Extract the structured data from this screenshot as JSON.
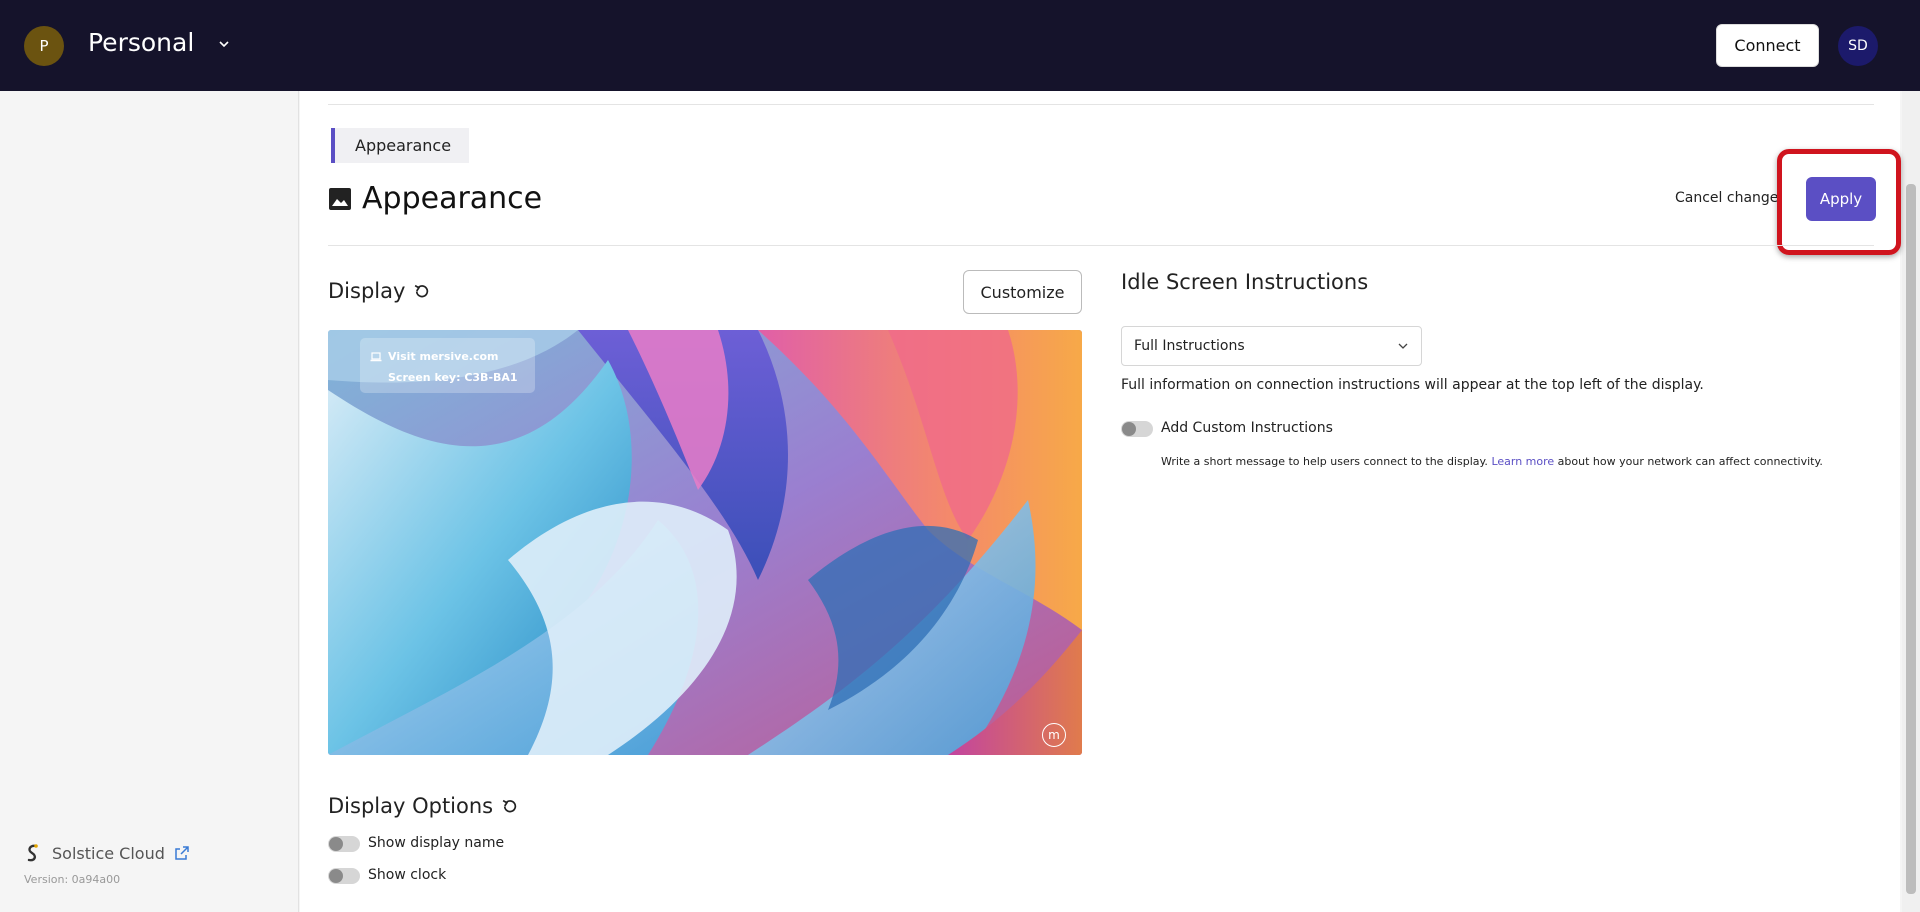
{
  "header": {
    "workspace_initial": "P",
    "workspace_name": "Personal",
    "connect_label": "Connect",
    "user_initials": "SD"
  },
  "sidebar": {
    "brand_name": "Solstice Cloud",
    "version": "Version: 0a94a00"
  },
  "breadcrumb": "Appearance",
  "page_title": "Appearance",
  "actions": {
    "cancel_label": "Cancel changes",
    "apply_label": "Apply"
  },
  "display": {
    "title": "Display",
    "customize_label": "Customize",
    "preview_card": {
      "line1": "Visit mersive.com",
      "line2": "Screen key: C3B-BA1"
    },
    "logo_glyph": "m"
  },
  "display_options": {
    "title": "Display Options",
    "toggles": [
      {
        "label": "Show display name",
        "on": false
      },
      {
        "label": "Show clock",
        "on": false
      }
    ]
  },
  "idle": {
    "title": "Idle Screen Instructions",
    "dropdown_value": "Full Instructions",
    "info": "Full information on connection instructions will appear at the top left of the display.",
    "custom_toggle_label": "Add Custom Instructions",
    "custom_toggle_on": false,
    "help_prefix": "Write a short message to help users connect to the display.",
    "help_link": "Learn more",
    "help_suffix": "about how your network can affect connectivity."
  },
  "colors": {
    "header_bg": "#15132b",
    "accent": "#5b4fc4",
    "highlight": "#d0141e",
    "workspace_avatar": "#6b5310",
    "user_avatar": "#1c1a6b"
  }
}
